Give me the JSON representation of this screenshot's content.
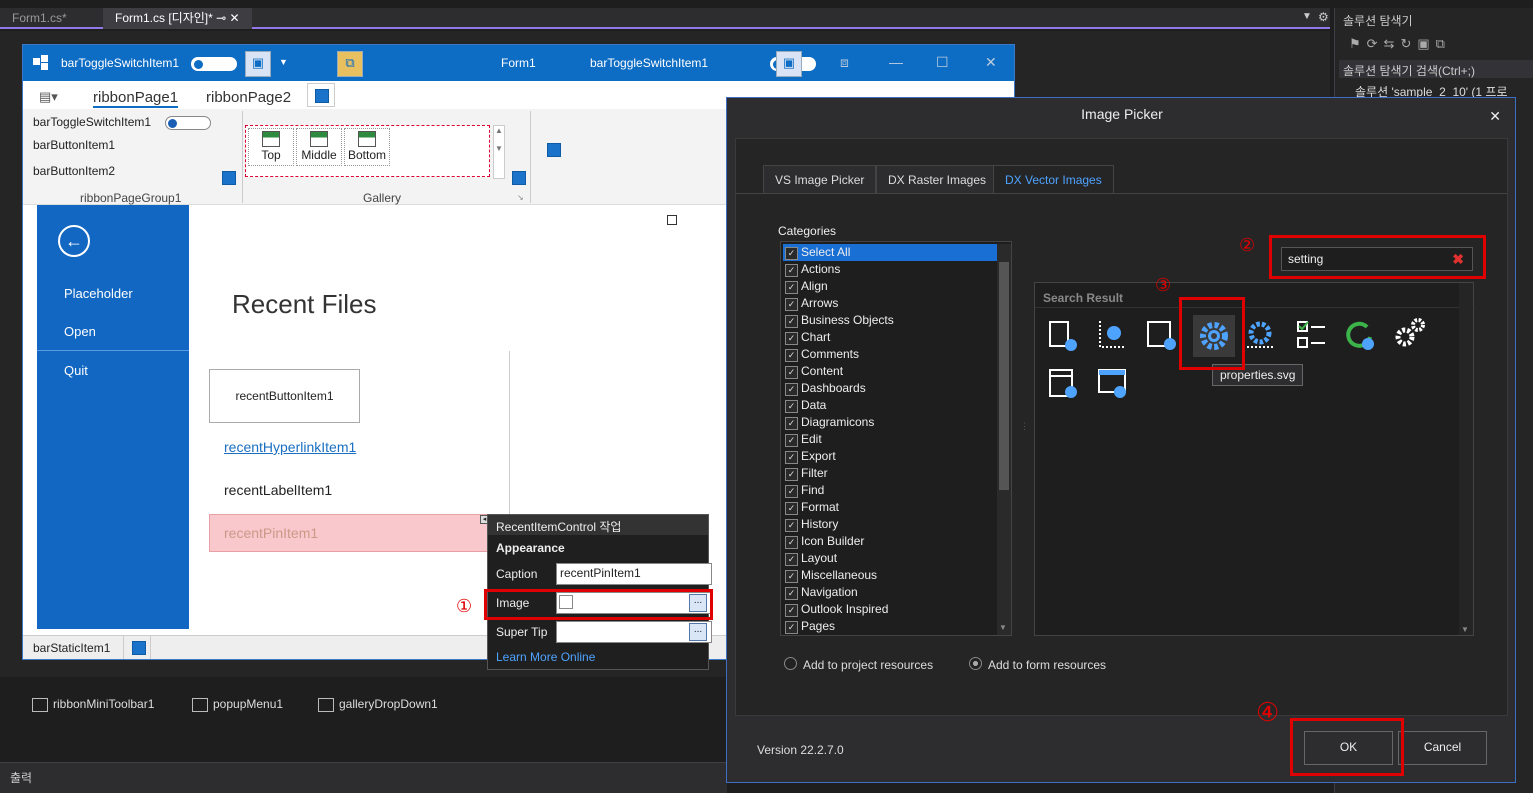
{
  "vs_tabs": {
    "tab1": "Form1.cs*",
    "tab2": "Form1.cs [디자인]*",
    "pin": "⊸"
  },
  "form": {
    "title": "Form1",
    "toggle_label_left": "barToggleSwitchItem1",
    "toggle_label_right": "barToggleSwitchItem1",
    "ribbon_tabs": [
      "ribbonPage1",
      "ribbonPage2"
    ],
    "ribbon_items": {
      "toggle": "barToggleSwitchItem1",
      "button1": "barButtonItem1",
      "button2": "barButtonItem2"
    },
    "group1": "ribbonPageGroup1",
    "group2": "Gallery",
    "gallery_items": [
      "Top",
      "Middle",
      "Bottom"
    ],
    "status_item": "barStaticItem1",
    "behind_status_item": "barStaticItem1"
  },
  "backstage": {
    "items": [
      "Placeholder",
      "Open",
      "Quit"
    ],
    "title": "Recent Files",
    "recent_button": "recentButtonItem1",
    "recent_hyperlink": "recentHyperlinkItem1",
    "recent_label": "recentLabelItem1",
    "recent_pin": "recentPinItem1"
  },
  "smarttag": {
    "title": "RecentItemControl 작업",
    "section": "Appearance",
    "caption_label": "Caption",
    "caption_value": "recentPinItem1",
    "image_label": "Image",
    "supertip_label": "Super Tip",
    "ellipsis": "...",
    "link": "Learn More Online"
  },
  "tray": {
    "items": [
      "ribbonMiniToolbar1",
      "popupMenu1",
      "galleryDropDown1"
    ]
  },
  "output_label": "출력",
  "solution_explorer": {
    "title": "솔루션 탐색기",
    "search": "솔루션 탐색기 검색(Ctrl+;)",
    "node": "솔루션 'sample_2_10' (1 프로"
  },
  "dialog": {
    "title": "Image Picker",
    "close": "✕",
    "tabs": [
      "VS Image Picker",
      "DX Raster Images",
      "DX Vector Images"
    ],
    "categories_label": "Categories",
    "categories": [
      "Select All",
      "Actions",
      "Align",
      "Arrows",
      "Business Objects",
      "Chart",
      "Comments",
      "Content",
      "Dashboards",
      "Data",
      "Diagramicons",
      "Edit",
      "Export",
      "Filter",
      "Find",
      "Format",
      "History",
      "Icon Builder",
      "Layout",
      "Miscellaneous",
      "Navigation",
      "Outlook Inspired",
      "Pages"
    ],
    "search_value": "setting",
    "search_clear": "✖",
    "result_label": "Search Result",
    "tooltip": "properties.svg",
    "radio_project": "Add to project resources",
    "radio_form": "Add to form resources",
    "version": "Version 22.2.7.0",
    "ok": "OK",
    "cancel": "Cancel"
  },
  "annotations": {
    "n1": "①",
    "n2": "②",
    "n3": "③",
    "n4": "④"
  },
  "colors": {
    "accent": "#0d6cc4",
    "highlight": "#e00000",
    "selection": "#1a6fd4"
  }
}
